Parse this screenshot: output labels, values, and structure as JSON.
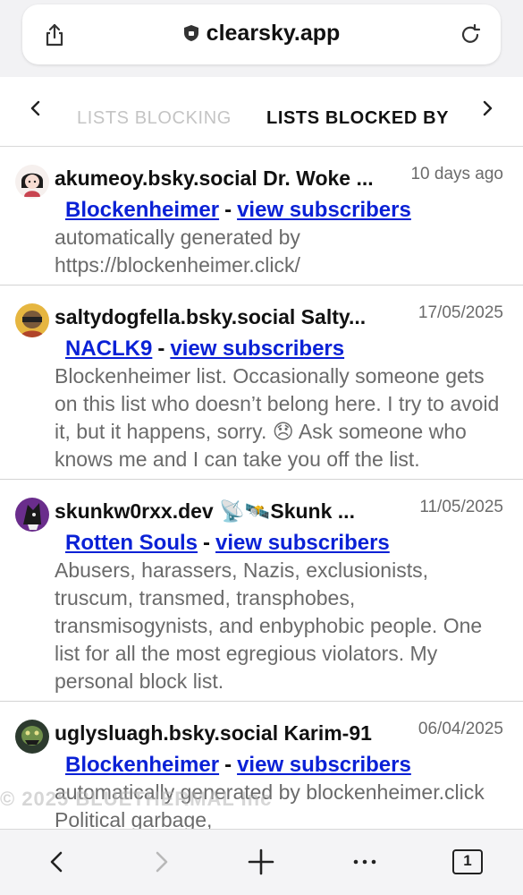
{
  "browser": {
    "url": "clearsky.app"
  },
  "tabs": {
    "inactive": "LISTS BLOCKING",
    "active": "LISTS BLOCKED BY"
  },
  "items": [
    {
      "handle": "akumeoy.bsky.social Dr. Woke ...",
      "date": "10 days ago",
      "list_name": "Blockenheimer",
      "view_label": "view subscribers",
      "separator": "-",
      "description": "automatically generated by https://blockenheimer.click/"
    },
    {
      "handle": "saltydogfella.bsky.social Salty...",
      "date": "17/05/2025",
      "list_name": "NACLK9",
      "view_label": "view subscribers",
      "separator": "-",
      "description": "Blockenheimer list. Occasionally someone gets on this list who doesn’t belong here. I try to avoid it, but it happens, sorry. 😞 Ask someone who knows me and I can take you off the list."
    },
    {
      "handle": "skunkw0rxx.dev 📡🛰️Skunk ...",
      "date": "11/05/2025",
      "list_name": "Rotten Souls",
      "view_label": "view subscribers",
      "separator": "-",
      "description": "Abusers, harassers, Nazis, exclusionists, truscum, transmed, transphobes, transmisogynists, and enbyphobic people. One list for all the most egregious violators. My personal block list."
    },
    {
      "handle": "uglysluagh.bsky.social Karim-91",
      "date": "06/04/2025",
      "list_name": "Blockenheimer",
      "view_label": "view subscribers",
      "separator": "-",
      "description": "automatically generated by blockenheimer.click Political garbage,"
    }
  ],
  "watermark": "© 2025 BLUETHERMAL Inc",
  "toolbar": {
    "tab_count": "1"
  },
  "colors": {
    "link": "#0a21d6",
    "muted_text": "#6a6a6a"
  }
}
